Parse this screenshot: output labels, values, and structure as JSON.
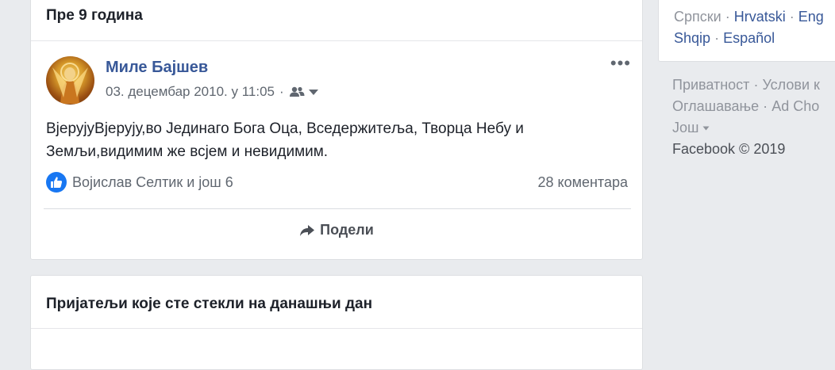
{
  "post_card": {
    "header_title": "Пре 9 година",
    "author": "Миле Бајшев",
    "date": "03. децембар 2010. у 11:05",
    "separator": "·",
    "more_label": "•••",
    "text_line1": "ВјерујуВјерују,во Јединаго Бога Оца, Вседержитеља, Творца Небу и",
    "text_line2": "Земљи,видимим же всјем и невидимим.",
    "reactions_text": "Војислав Селтик и још 6",
    "comments_text": "28 коментара",
    "share_label": "Подели"
  },
  "friends_card": {
    "header_title": "Пријатељи које сте стекли на данашњи дан"
  },
  "sidebar": {
    "languages": {
      "current": "Српски",
      "sep": "·",
      "items": [
        "Hrvatski",
        "Eng",
        "Shqip",
        "Español"
      ]
    },
    "footer": {
      "privacy": "Приватност",
      "terms": "Услови к",
      "ads": "Оглашавање",
      "ad_choices": "Ad Cho",
      "more": "Још",
      "copyright": "Facebook © 2019",
      "sep": "·"
    }
  },
  "colors": {
    "link_blue": "#385898",
    "like_blue": "#1877f2",
    "background": "#e9ebee"
  },
  "icons": [
    "friends-audience-icon",
    "dropdown-caret-icon",
    "like-icon",
    "share-arrow-icon",
    "more-options-icon"
  ]
}
